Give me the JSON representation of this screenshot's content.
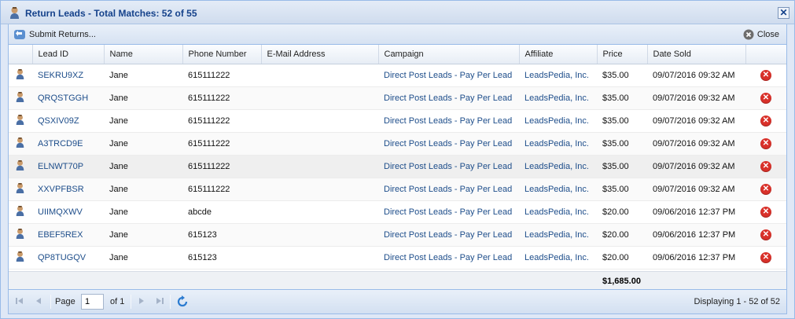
{
  "window": {
    "title": "Return Leads - Total Matches: 52 of 55",
    "close_symbol": "✕"
  },
  "toolbar": {
    "submit_label": "Submit Returns...",
    "close_label": "Close"
  },
  "grid": {
    "columns": [
      "",
      "Lead ID",
      "Name",
      "Phone Number",
      "E-Mail Address",
      "Campaign",
      "Affiliate",
      "Price",
      "Date Sold",
      ""
    ],
    "rows": [
      {
        "lead_id": "SEKRU9XZ",
        "name": "Jane",
        "phone": "615111222",
        "email": "",
        "campaign": "Direct Post Leads - Pay Per Lead",
        "affiliate": "LeadsPedia, Inc.",
        "price": "$35.00",
        "date_sold": "09/07/2016 09:32 AM"
      },
      {
        "lead_id": "QRQSTGGH",
        "name": "Jane",
        "phone": "615111222",
        "email": "",
        "campaign": "Direct Post Leads - Pay Per Lead",
        "affiliate": "LeadsPedia, Inc.",
        "price": "$35.00",
        "date_sold": "09/07/2016 09:32 AM"
      },
      {
        "lead_id": "QSXIV09Z",
        "name": "Jane",
        "phone": "615111222",
        "email": "",
        "campaign": "Direct Post Leads - Pay Per Lead",
        "affiliate": "LeadsPedia, Inc.",
        "price": "$35.00",
        "date_sold": "09/07/2016 09:32 AM"
      },
      {
        "lead_id": "A3TRCD9E",
        "name": "Jane",
        "phone": "615111222",
        "email": "",
        "campaign": "Direct Post Leads - Pay Per Lead",
        "affiliate": "LeadsPedia, Inc.",
        "price": "$35.00",
        "date_sold": "09/07/2016 09:32 AM"
      },
      {
        "lead_id": "ELNWT70P",
        "name": "Jane",
        "phone": "615111222",
        "email": "",
        "campaign": "Direct Post Leads - Pay Per Lead",
        "affiliate": "LeadsPedia, Inc.",
        "price": "$35.00",
        "date_sold": "09/07/2016 09:32 AM"
      },
      {
        "lead_id": "XXVPFBSR",
        "name": "Jane",
        "phone": "615111222",
        "email": "",
        "campaign": "Direct Post Leads - Pay Per Lead",
        "affiliate": "LeadsPedia, Inc.",
        "price": "$35.00",
        "date_sold": "09/07/2016 09:32 AM"
      },
      {
        "lead_id": "UIIMQXWV",
        "name": "Jane",
        "phone": "abcde",
        "email": "",
        "campaign": "Direct Post Leads - Pay Per Lead",
        "affiliate": "LeadsPedia, Inc.",
        "price": "$20.00",
        "date_sold": "09/06/2016 12:37 PM"
      },
      {
        "lead_id": "EBEF5REX",
        "name": "Jane",
        "phone": "615123",
        "email": "",
        "campaign": "Direct Post Leads - Pay Per Lead",
        "affiliate": "LeadsPedia, Inc.",
        "price": "$20.00",
        "date_sold": "09/06/2016 12:37 PM"
      },
      {
        "lead_id": "QP8TUGQV",
        "name": "Jane",
        "phone": "615123",
        "email": "",
        "campaign": "Direct Post Leads - Pay Per Lead",
        "affiliate": "LeadsPedia, Inc.",
        "price": "$20.00",
        "date_sold": "09/06/2016 12:37 PM"
      }
    ],
    "summary_total": "$1,685.00",
    "hover_row_index": 4
  },
  "pager": {
    "page_label": "Page",
    "page_value": "1",
    "of_label": "of 1",
    "display_text": "Displaying 1 - 52 of 52"
  },
  "icons": {
    "row_icon": "user-icon",
    "delete_icon": "remove-circle-icon",
    "submit_icon": "return-arrow-icon",
    "close_icon": "close-circle-icon",
    "refresh_icon": "refresh-icon"
  },
  "colors": {
    "title": "#15428b",
    "link": "#1d4d8a",
    "delete": "#d9312a"
  }
}
